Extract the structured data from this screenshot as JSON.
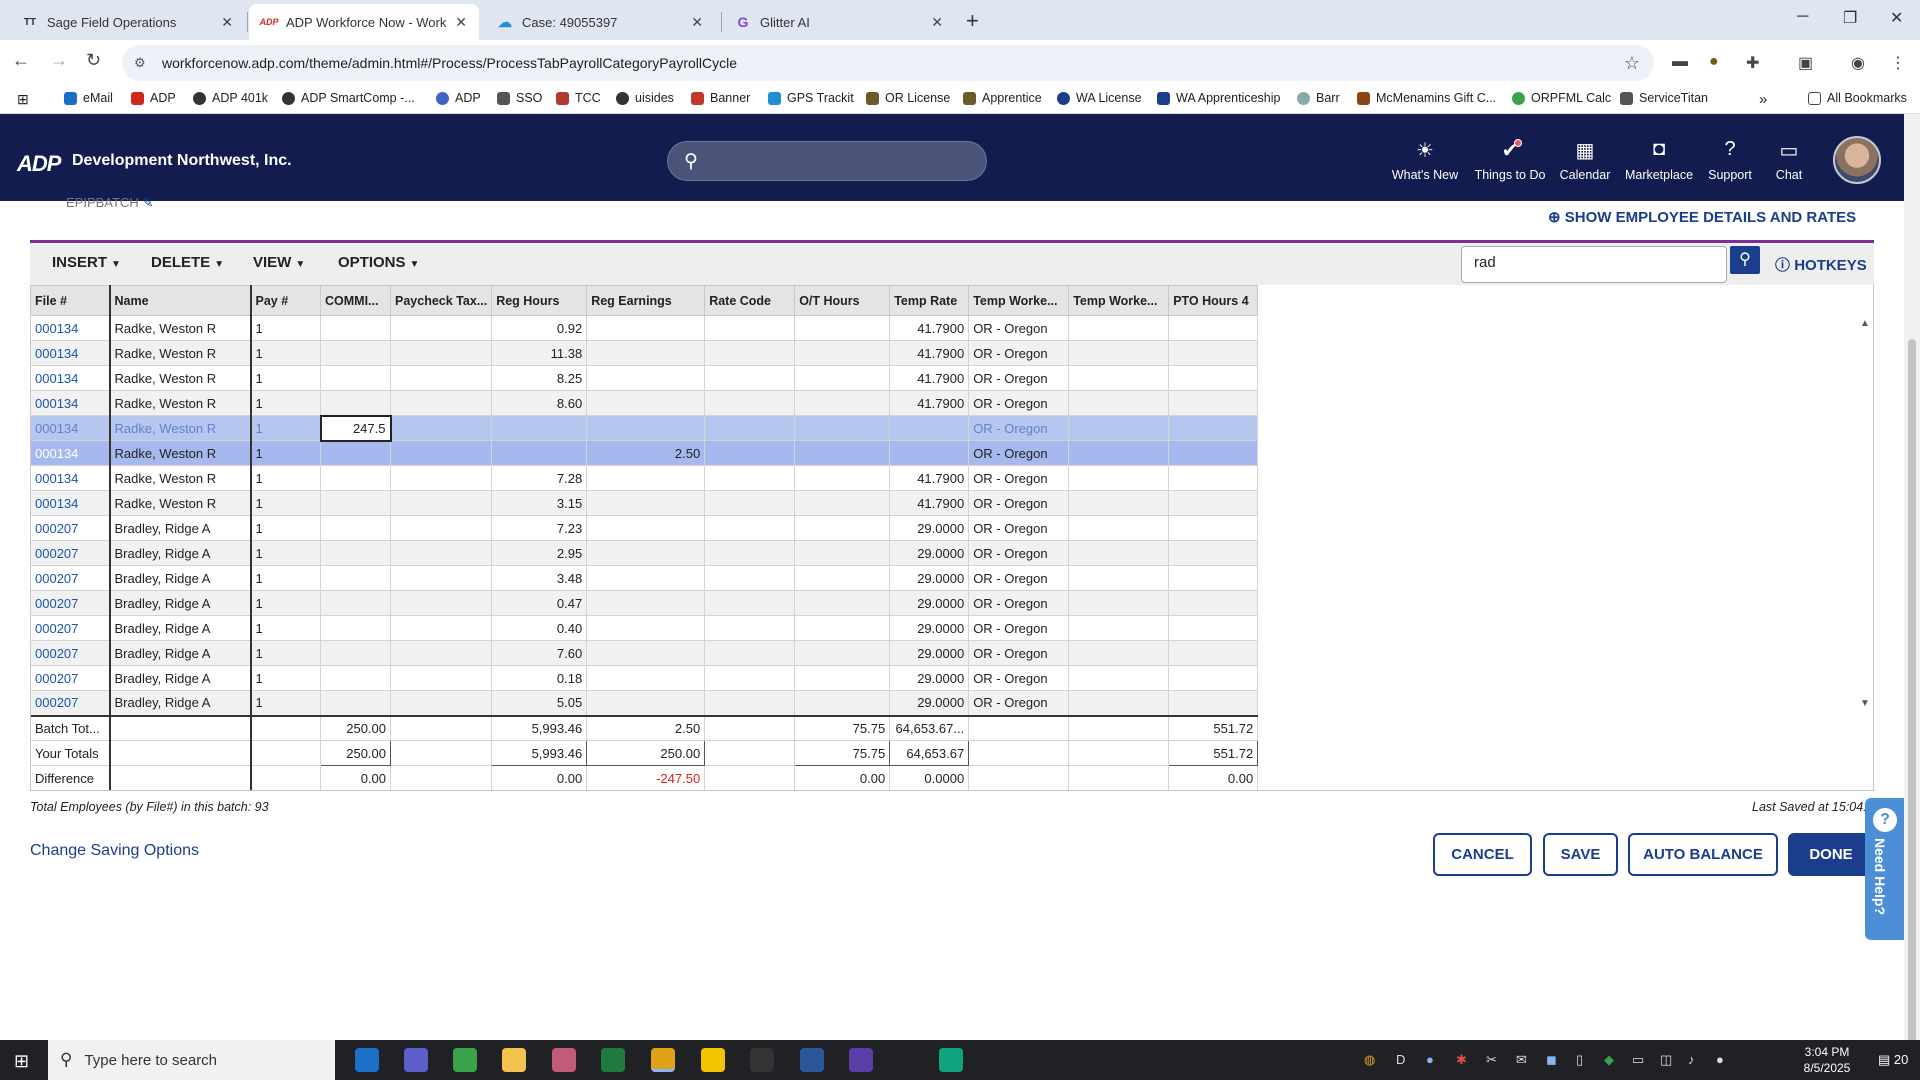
{
  "browser": {
    "tabs": [
      {
        "title": "Sage Field Operations",
        "icon": "sage-icon",
        "glyph": "TT",
        "color": "#333333"
      },
      {
        "title": "ADP Workforce Now - Workshe",
        "icon": "adp-icon",
        "glyph": "ADP",
        "color": "#d0271d"
      },
      {
        "title": "Case: 49055397",
        "icon": "salesforce-cloud-icon",
        "glyph": "☁",
        "color": "#1f8fd1"
      },
      {
        "title": "Glitter AI",
        "icon": "glitter-icon",
        "glyph": "G",
        "color": "#7c4ad8"
      }
    ],
    "url": "workforcenow.adp.com/theme/admin.html#/Process/ProcessTabPayrollCategoryPayrollCycle",
    "bookmarks": [
      "eMail",
      "ADP",
      "ADP 401k",
      "ADP SmartComp -...",
      "ADP",
      "SSO",
      "TCC",
      "uisides",
      "Banner",
      "GPS Trackit",
      "OR License",
      "Apprentice",
      "WA License",
      "WA Apprenticeship",
      "Barr",
      "McMenamins Gift C...",
      "ORPFML Calc",
      "ServiceTitan"
    ],
    "bookmarks_more": "»",
    "all_bookmarks": "All Bookmarks"
  },
  "adp": {
    "logo": "ADP",
    "company": "Development Northwest, Inc.",
    "nav": [
      {
        "label": "What's New",
        "icon": "lightbulb-icon",
        "glyph": "💡"
      },
      {
        "label": "Things to Do",
        "icon": "checkmark-icon",
        "glyph": "✔"
      },
      {
        "label": "Calendar",
        "icon": "calendar-icon",
        "glyph": "▦"
      },
      {
        "label": "Marketplace",
        "icon": "shopping-bag-icon",
        "glyph": "👜"
      },
      {
        "label": "Support",
        "icon": "help-icon",
        "glyph": "?"
      },
      {
        "label": "Chat",
        "icon": "chat-icon",
        "glyph": "▭"
      }
    ]
  },
  "page": {
    "batch_name": "EPIPBATCH",
    "show_details": "SHOW EMPLOYEE DETAILS AND RATES",
    "toolbar": [
      "INSERT",
      "DELETE",
      "VIEW",
      "OPTIONS"
    ],
    "search_value": "rad",
    "hotkeys": "HOTKEYS",
    "total_employees": "Total Employees (by File#) in this batch: 93",
    "last_saved": "Last Saved at 15:04:",
    "change_saving": "Change Saving Options",
    "buttons": {
      "cancel": "CANCEL",
      "save": "SAVE",
      "auto_balance": "AUTO BALANCE",
      "done": "DONE"
    },
    "need_help": "Need Help?"
  },
  "grid": {
    "columns": [
      "File #",
      "Name",
      "Pay #",
      "COMMI...",
      "Paycheck Tax...",
      "Reg Hours",
      "Reg Earnings",
      "Rate Code",
      "O/T Hours",
      "Temp Rate",
      "Temp Worke...",
      "Temp Worke...",
      "PTO Hours 4"
    ],
    "rows": [
      [
        "000134",
        "Radke, Weston R",
        "1",
        "",
        "",
        "0.92",
        "",
        "",
        "",
        "41.7900",
        "OR - Oregon",
        "",
        ""
      ],
      [
        "000134",
        "Radke, Weston R",
        "1",
        "",
        "",
        "11.38",
        "",
        "",
        "",
        "41.7900",
        "OR - Oregon",
        "",
        ""
      ],
      [
        "000134",
        "Radke, Weston R",
        "1",
        "",
        "",
        "8.25",
        "",
        "",
        "",
        "41.7900",
        "OR - Oregon",
        "",
        ""
      ],
      [
        "000134",
        "Radke, Weston R",
        "1",
        "",
        "",
        "8.60",
        "",
        "",
        "",
        "41.7900",
        "OR - Oregon",
        "",
        ""
      ],
      [
        "000134",
        "Radke, Weston R",
        "1",
        "247.5",
        "",
        "",
        "",
        "",
        "",
        "",
        "OR - Oregon",
        "",
        ""
      ],
      [
        "000134",
        "Radke, Weston R",
        "1",
        "",
        "",
        "",
        "2.50",
        "",
        "",
        "",
        "OR - Oregon",
        "",
        ""
      ],
      [
        "000134",
        "Radke, Weston R",
        "1",
        "",
        "",
        "7.28",
        "",
        "",
        "",
        "41.7900",
        "OR - Oregon",
        "",
        ""
      ],
      [
        "000134",
        "Radke, Weston R",
        "1",
        "",
        "",
        "3.15",
        "",
        "",
        "",
        "41.7900",
        "OR - Oregon",
        "",
        ""
      ],
      [
        "000207",
        "Bradley, Ridge A",
        "1",
        "",
        "",
        "7.23",
        "",
        "",
        "",
        "29.0000",
        "OR - Oregon",
        "",
        ""
      ],
      [
        "000207",
        "Bradley, Ridge A",
        "1",
        "",
        "",
        "2.95",
        "",
        "",
        "",
        "29.0000",
        "OR - Oregon",
        "",
        ""
      ],
      [
        "000207",
        "Bradley, Ridge A",
        "1",
        "",
        "",
        "3.48",
        "",
        "",
        "",
        "29.0000",
        "OR - Oregon",
        "",
        ""
      ],
      [
        "000207",
        "Bradley, Ridge A",
        "1",
        "",
        "",
        "0.47",
        "",
        "",
        "",
        "29.0000",
        "OR - Oregon",
        "",
        ""
      ],
      [
        "000207",
        "Bradley, Ridge A",
        "1",
        "",
        "",
        "0.40",
        "",
        "",
        "",
        "29.0000",
        "OR - Oregon",
        "",
        ""
      ],
      [
        "000207",
        "Bradley, Ridge A",
        "1",
        "",
        "",
        "7.60",
        "",
        "",
        "",
        "29.0000",
        "OR - Oregon",
        "",
        ""
      ],
      [
        "000207",
        "Bradley, Ridge A",
        "1",
        "",
        "",
        "0.18",
        "",
        "",
        "",
        "29.0000",
        "OR - Oregon",
        "",
        ""
      ],
      [
        "000207",
        "Bradley, Ridge A",
        "1",
        "",
        "",
        "5.05",
        "",
        "",
        "",
        "29.0000",
        "OR - Oregon",
        "",
        ""
      ]
    ],
    "selected_rows": [
      4,
      5
    ],
    "editing_cell_value": "247.5",
    "totals": [
      [
        "Batch Tot...",
        "",
        "",
        "250.00",
        "",
        "5,993.46",
        "2.50",
        "",
        "75.75",
        "64,653.67...",
        "",
        "",
        "551.72"
      ],
      [
        "Your Totals",
        "",
        "",
        "250.00",
        "",
        "5,993.46",
        "250.00",
        "",
        "75.75",
        "64,653.67",
        "",
        "",
        "551.72"
      ],
      [
        "Difference",
        "",
        "",
        "0.00",
        "",
        "0.00",
        "-247.50",
        "",
        "0.00",
        "0.0000",
        "",
        "",
        "0.00"
      ]
    ],
    "colors": {
      "selected": "#a5b9ee",
      "link": "#1a56b0",
      "negative": "#d91f1f",
      "accent": "#1a3e8c"
    }
  },
  "taskbar": {
    "search_placeholder": "Type here to search",
    "apps": [
      {
        "icon": "outlook-icon",
        "color": "#1c6fc7"
      },
      {
        "icon": "teams-icon",
        "color": "#5b5fc7"
      },
      {
        "icon": "greenshot-icon",
        "color": "#3aa24a"
      },
      {
        "icon": "file-explorer-icon",
        "color": "#f2c14e"
      },
      {
        "icon": "edge-dev-icon",
        "color": "#c25b7a"
      },
      {
        "icon": "excel-icon",
        "color": "#1f7a3e"
      },
      {
        "icon": "chrome-icon",
        "color": "#e0a21a"
      },
      {
        "icon": "norton-icon",
        "color": "#f4c300"
      },
      {
        "icon": "acrobat-icon",
        "color": "#333333"
      },
      {
        "icon": "word-icon",
        "color": "#2b579a"
      },
      {
        "icon": "app-q-icon",
        "color": "#5a3ea8"
      },
      {
        "icon": "chatgpt-icon",
        "color": "#10a37f"
      }
    ],
    "time": "3:04 PM",
    "date": "8/5/2025",
    "notifications": "20"
  }
}
